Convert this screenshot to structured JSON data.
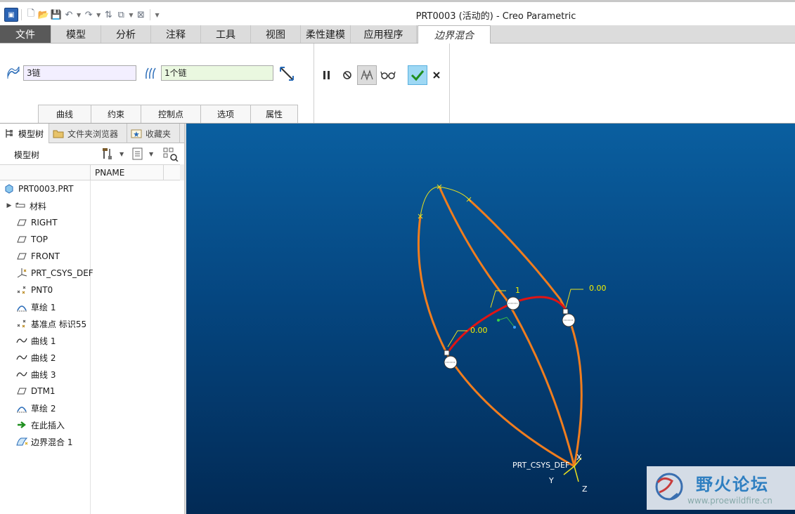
{
  "window": {
    "title": "PRT0003 (活动的) - Creo Parametric"
  },
  "ribbon_tabs": [
    "文件",
    "模型",
    "分析",
    "注释",
    "工具",
    "视图",
    "柔性建模",
    "应用程序",
    "边界混合"
  ],
  "dashboard": {
    "first_direction": "3链",
    "second_direction": "1个链",
    "subtabs": [
      "曲线",
      "约束",
      "控制点",
      "选项",
      "属性"
    ]
  },
  "nav_tabs": [
    "模型树",
    "文件夹浏览器",
    "收藏夹"
  ],
  "tree": {
    "title": "模型树",
    "column": "PNAME",
    "items": [
      {
        "label": "PRT0003.PRT",
        "icon": "part-icon"
      },
      {
        "label": "材料",
        "icon": "material-icon"
      },
      {
        "label": "RIGHT",
        "icon": "datum-plane-icon"
      },
      {
        "label": "TOP",
        "icon": "datum-plane-icon"
      },
      {
        "label": "FRONT",
        "icon": "datum-plane-icon"
      },
      {
        "label": "PRT_CSYS_DEF",
        "icon": "csys-icon"
      },
      {
        "label": "PNT0",
        "icon": "datum-point-icon"
      },
      {
        "label": "草绘 1",
        "icon": "sketch-icon"
      },
      {
        "label": "基准点 标识55",
        "icon": "datum-point-icon"
      },
      {
        "label": "曲线 1",
        "icon": "curve-icon"
      },
      {
        "label": "曲线 2",
        "icon": "curve-icon"
      },
      {
        "label": "曲线 3",
        "icon": "curve-icon"
      },
      {
        "label": "DTM1",
        "icon": "datum-plane-icon"
      },
      {
        "label": "草绘 2",
        "icon": "sketch-icon"
      },
      {
        "label": "在此插入",
        "icon": "insert-here-icon"
      },
      {
        "label": "边界混合 1",
        "icon": "boundary-blend-icon"
      }
    ]
  },
  "viewport": {
    "labels": {
      "tension_1": "1",
      "tension_2": "0.00",
      "tension_3": "0.00",
      "csys": "PRT_CSYS_DEF",
      "axis_x": "X",
      "axis_y": "Y",
      "axis_z": "Z"
    },
    "colors": {
      "curves": "#f07d1e",
      "chain": "#e01414",
      "label": "#f4f000"
    }
  },
  "watermark": {
    "title": "野火论坛",
    "url": "www.proewildfire.cn"
  }
}
